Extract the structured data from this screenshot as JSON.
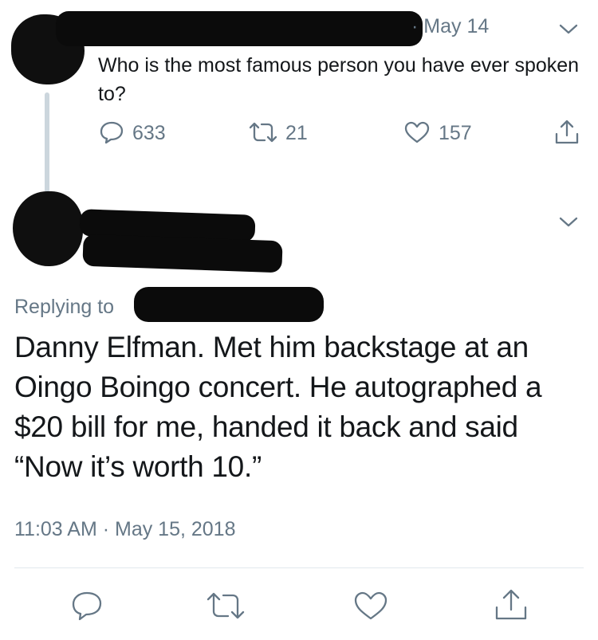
{
  "parent_tweet": {
    "date": "· May 14",
    "text": "Who is the most famous person you have ever spoken to?",
    "actions": {
      "reply_count": "633",
      "retweet_count": "21",
      "like_count": "157"
    },
    "icons": [
      "reply-icon",
      "retweet-icon",
      "like-icon",
      "share-icon",
      "chevron-down-icon"
    ]
  },
  "reply_tweet": {
    "replying_to_label": "Replying to",
    "text": "Danny Elfman. Met him backstage at an Oingo Boingo concert. He autographed a $20 bill for me, handed it back and said “Now it’s worth 10.”",
    "timestamp": "11:03 AM · May 15, 2018",
    "icons": [
      "reply-icon",
      "retweet-icon",
      "like-icon",
      "share-icon",
      "chevron-down-icon"
    ]
  },
  "colors": {
    "text": "#14171a",
    "muted": "#657786",
    "thread_line": "#ccd6dd",
    "redaction": "#0b0b0b"
  }
}
